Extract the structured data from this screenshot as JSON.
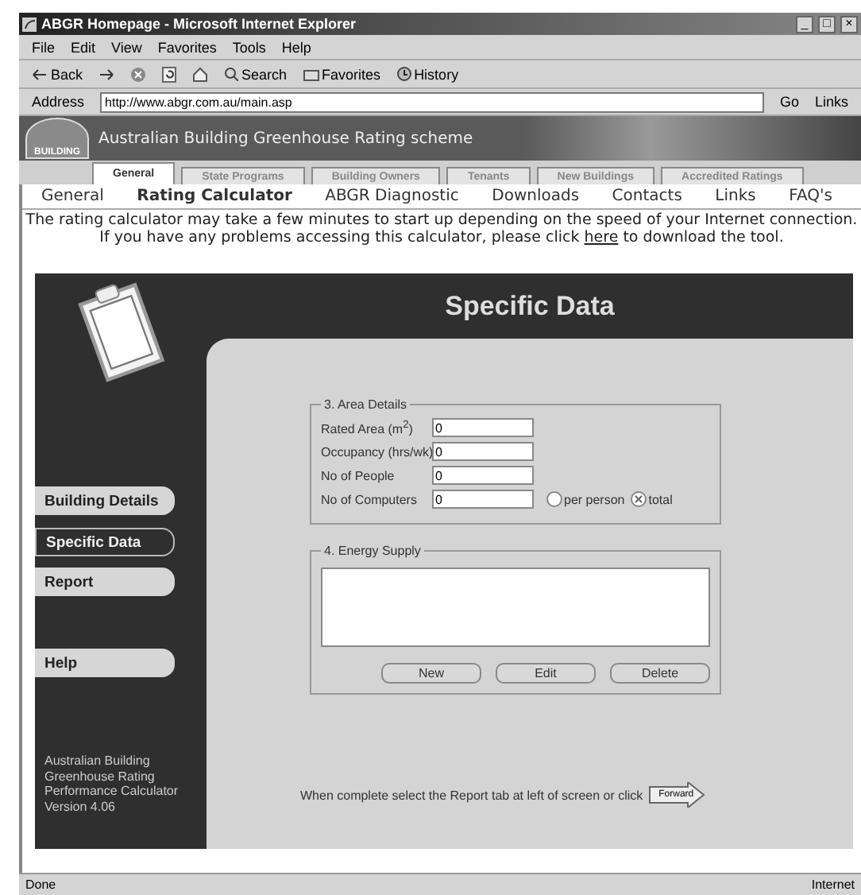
{
  "window": {
    "title": "ABGR Homepage - Microsoft Internet Explorer",
    "controls": [
      "_",
      "□",
      "×"
    ]
  },
  "menu": [
    "File",
    "Edit",
    "View",
    "Favorites",
    "Tools",
    "Help"
  ],
  "toolbar": [
    {
      "label": "Back",
      "kind": "back"
    },
    {
      "kind": "forward"
    },
    {
      "kind": "stop"
    },
    {
      "kind": "refresh"
    },
    {
      "kind": "home"
    },
    {
      "label": "Search",
      "kind": "search"
    },
    {
      "label": "Favorites",
      "kind": "favorites"
    },
    {
      "label": "History",
      "kind": "history"
    }
  ],
  "address": {
    "label": "Address",
    "url": "http://www.abgr.com.au/main.asp",
    "go": "Go",
    "links": "Links"
  },
  "banner": {
    "title": "Australian Building Greenhouse Rating scheme",
    "logo": "BUILDING"
  },
  "tabs": [
    {
      "label": "General",
      "selected": true
    },
    {
      "label": "State Programs",
      "selected": false
    },
    {
      "label": "Building Owners",
      "selected": false
    },
    {
      "label": "Tenants",
      "selected": false
    },
    {
      "label": "New Buildings",
      "selected": false
    },
    {
      "label": "Accredited Ratings",
      "selected": false
    }
  ],
  "nav": [
    {
      "label": "General",
      "selected": false
    },
    {
      "label": "Rating Calculator",
      "selected": true
    },
    {
      "label": "ABGR Diagnostic",
      "selected": false
    },
    {
      "label": "Downloads",
      "selected": false
    },
    {
      "label": "Contacts",
      "selected": false
    },
    {
      "label": "Links",
      "selected": false
    },
    {
      "label": "FAQ's",
      "selected": false
    }
  ],
  "notice": {
    "line1": "The rating calculator may take a few minutes to start up depending on the speed of your Internet connection.",
    "line2_before": "If you have any problems accessing this calculator, please click",
    "link": "here",
    "line2_after": "to download the tool."
  },
  "app": {
    "header": "Specific Data",
    "sidebar": [
      {
        "label": "Building Details",
        "selected": false
      },
      {
        "label": "Specific Data",
        "selected": true
      },
      {
        "label": "Report",
        "selected": false
      },
      {
        "label": "Help",
        "selected": false
      }
    ],
    "footer": [
      "Australian Building",
      "Greenhouse Rating",
      "Performance Calculator",
      "Version 4.06"
    ],
    "area_details": {
      "legend": "3. Area Details",
      "fields": [
        {
          "label": "Rated Area (m$^{2}$)",
          "value": "0"
        },
        {
          "label": "Occupancy (hrs/wk)",
          "value": "0"
        },
        {
          "label": "No of People",
          "value": "0"
        },
        {
          "label": "No of Computers",
          "value": "0"
        }
      ],
      "radios": [
        {
          "label": "per person",
          "selected": false
        },
        {
          "label": "total",
          "selected": true
        }
      ]
    },
    "energy_supply": {
      "legend": "4. Energy Supply",
      "buttons": [
        "New",
        "Edit",
        "Delete"
      ]
    },
    "forward": {
      "text": "When complete select the Report tab at left of screen or click",
      "button": "Forward"
    }
  },
  "status": {
    "text": "Done",
    "zone": "Internet"
  }
}
